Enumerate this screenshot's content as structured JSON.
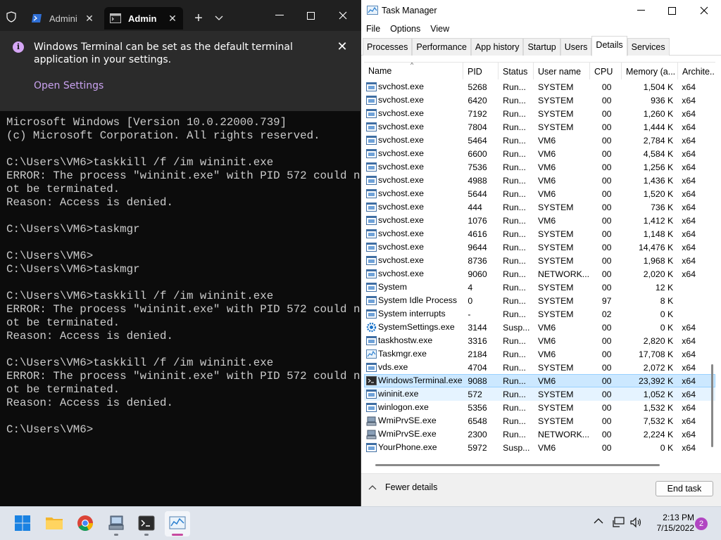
{
  "terminal": {
    "tabs": [
      {
        "label": "Admini",
        "icon": "powershell-icon"
      },
      {
        "label": "Admin",
        "icon": "cmd-icon",
        "active": true
      }
    ],
    "infobar": {
      "message": "Windows Terminal can be set as the default terminal application in your settings.",
      "link": "Open Settings"
    },
    "lines": [
      "Microsoft Windows [Version 10.0.22000.739]",
      "(c) Microsoft Corporation. All rights reserved.",
      "",
      "C:\\Users\\VM6>taskkill /f /im wininit.exe",
      "ERROR: The process \"wininit.exe\" with PID 572 could n",
      "ot be terminated.",
      "Reason: Access is denied.",
      "",
      "C:\\Users\\VM6>taskmgr",
      "",
      "C:\\Users\\VM6>",
      "C:\\Users\\VM6>taskmgr",
      "",
      "C:\\Users\\VM6>taskkill /f /im wininit.exe",
      "ERROR: The process \"wininit.exe\" with PID 572 could n",
      "ot be terminated.",
      "Reason: Access is denied.",
      "",
      "C:\\Users\\VM6>taskkill /f /im wininit.exe",
      "ERROR: The process \"wininit.exe\" with PID 572 could n",
      "ot be terminated.",
      "Reason: Access is denied.",
      "",
      "C:\\Users\\VM6>"
    ]
  },
  "taskmgr": {
    "title": "Task Manager",
    "menu": [
      "File",
      "Options",
      "View"
    ],
    "tabs": [
      "Processes",
      "Performance",
      "App history",
      "Startup",
      "Users",
      "Details",
      "Services"
    ],
    "active_tab": "Details",
    "columns": {
      "name": "Name",
      "pid": "PID",
      "status": "Status",
      "user": "User name",
      "cpu": "CPU",
      "mem": "Memory (a...",
      "arch": "Archite..."
    },
    "rows": [
      {
        "name": "svchost.exe",
        "pid": "5268",
        "status": "Run...",
        "user": "SYSTEM",
        "cpu": "00",
        "mem": "1,504 K",
        "arch": "x64",
        "icon": "service"
      },
      {
        "name": "svchost.exe",
        "pid": "6420",
        "status": "Run...",
        "user": "SYSTEM",
        "cpu": "00",
        "mem": "936 K",
        "arch": "x64",
        "icon": "service"
      },
      {
        "name": "svchost.exe",
        "pid": "7192",
        "status": "Run...",
        "user": "SYSTEM",
        "cpu": "00",
        "mem": "1,260 K",
        "arch": "x64",
        "icon": "service"
      },
      {
        "name": "svchost.exe",
        "pid": "7804",
        "status": "Run...",
        "user": "SYSTEM",
        "cpu": "00",
        "mem": "1,444 K",
        "arch": "x64",
        "icon": "service"
      },
      {
        "name": "svchost.exe",
        "pid": "5464",
        "status": "Run...",
        "user": "VM6",
        "cpu": "00",
        "mem": "2,784 K",
        "arch": "x64",
        "icon": "service"
      },
      {
        "name": "svchost.exe",
        "pid": "6600",
        "status": "Run...",
        "user": "VM6",
        "cpu": "00",
        "mem": "4,584 K",
        "arch": "x64",
        "icon": "service"
      },
      {
        "name": "svchost.exe",
        "pid": "7536",
        "status": "Run...",
        "user": "VM6",
        "cpu": "00",
        "mem": "1,256 K",
        "arch": "x64",
        "icon": "service"
      },
      {
        "name": "svchost.exe",
        "pid": "4988",
        "status": "Run...",
        "user": "VM6",
        "cpu": "00",
        "mem": "1,436 K",
        "arch": "x64",
        "icon": "service"
      },
      {
        "name": "svchost.exe",
        "pid": "5644",
        "status": "Run...",
        "user": "VM6",
        "cpu": "00",
        "mem": "1,520 K",
        "arch": "x64",
        "icon": "service"
      },
      {
        "name": "svchost.exe",
        "pid": "444",
        "status": "Run...",
        "user": "SYSTEM",
        "cpu": "00",
        "mem": "736 K",
        "arch": "x64",
        "icon": "service"
      },
      {
        "name": "svchost.exe",
        "pid": "1076",
        "status": "Run...",
        "user": "VM6",
        "cpu": "00",
        "mem": "1,412 K",
        "arch": "x64",
        "icon": "service"
      },
      {
        "name": "svchost.exe",
        "pid": "4616",
        "status": "Run...",
        "user": "SYSTEM",
        "cpu": "00",
        "mem": "1,148 K",
        "arch": "x64",
        "icon": "service"
      },
      {
        "name": "svchost.exe",
        "pid": "9644",
        "status": "Run...",
        "user": "SYSTEM",
        "cpu": "00",
        "mem": "14,476 K",
        "arch": "x64",
        "icon": "service"
      },
      {
        "name": "svchost.exe",
        "pid": "8736",
        "status": "Run...",
        "user": "SYSTEM",
        "cpu": "00",
        "mem": "1,968 K",
        "arch": "x64",
        "icon": "service"
      },
      {
        "name": "svchost.exe",
        "pid": "9060",
        "status": "Run...",
        "user": "NETWORK...",
        "cpu": "00",
        "mem": "2,020 K",
        "arch": "x64",
        "icon": "service"
      },
      {
        "name": "System",
        "pid": "4",
        "status": "Run...",
        "user": "SYSTEM",
        "cpu": "00",
        "mem": "12 K",
        "arch": "",
        "icon": "service"
      },
      {
        "name": "System Idle Process",
        "pid": "0",
        "status": "Run...",
        "user": "SYSTEM",
        "cpu": "97",
        "mem": "8 K",
        "arch": "",
        "icon": "service"
      },
      {
        "name": "System interrupts",
        "pid": "-",
        "status": "Run...",
        "user": "SYSTEM",
        "cpu": "02",
        "mem": "0 K",
        "arch": "",
        "icon": "service"
      },
      {
        "name": "SystemSettings.exe",
        "pid": "3144",
        "status": "Susp...",
        "user": "VM6",
        "cpu": "00",
        "mem": "0 K",
        "arch": "x64",
        "icon": "settings"
      },
      {
        "name": "taskhostw.exe",
        "pid": "3316",
        "status": "Run...",
        "user": "VM6",
        "cpu": "00",
        "mem": "2,820 K",
        "arch": "x64",
        "icon": "service"
      },
      {
        "name": "Taskmgr.exe",
        "pid": "2184",
        "status": "Run...",
        "user": "VM6",
        "cpu": "00",
        "mem": "17,708 K",
        "arch": "x64",
        "icon": "taskmgr"
      },
      {
        "name": "vds.exe",
        "pid": "4704",
        "status": "Run...",
        "user": "SYSTEM",
        "cpu": "00",
        "mem": "2,072 K",
        "arch": "x64",
        "icon": "service"
      },
      {
        "name": "WindowsTerminal.exe",
        "pid": "9088",
        "status": "Run...",
        "user": "VM6",
        "cpu": "00",
        "mem": "23,392 K",
        "arch": "x64",
        "icon": "terminal",
        "selected": true
      },
      {
        "name": "wininit.exe",
        "pid": "572",
        "status": "Run...",
        "user": "SYSTEM",
        "cpu": "00",
        "mem": "1,052 K",
        "arch": "x64",
        "icon": "service",
        "hover": true
      },
      {
        "name": "winlogon.exe",
        "pid": "5356",
        "status": "Run...",
        "user": "SYSTEM",
        "cpu": "00",
        "mem": "1,532 K",
        "arch": "x64",
        "icon": "service"
      },
      {
        "name": "WmiPrvSE.exe",
        "pid": "6548",
        "status": "Run...",
        "user": "SYSTEM",
        "cpu": "00",
        "mem": "7,532 K",
        "arch": "x64",
        "icon": "wmi"
      },
      {
        "name": "WmiPrvSE.exe",
        "pid": "2300",
        "status": "Run...",
        "user": "NETWORK...",
        "cpu": "00",
        "mem": "2,224 K",
        "arch": "x64",
        "icon": "wmi"
      },
      {
        "name": "YourPhone.exe",
        "pid": "5972",
        "status": "Susp...",
        "user": "VM6",
        "cpu": "00",
        "mem": "0 K",
        "arch": "x64",
        "icon": "service"
      }
    ],
    "footer": {
      "fewer_details": "Fewer details",
      "end_task": "End task"
    }
  },
  "taskbar": {
    "apps": [
      "start-icon",
      "file-explorer-icon",
      "chrome-icon",
      "computer-management-icon",
      "terminal-icon",
      "taskmgr-icon"
    ],
    "time": "2:13 PM",
    "date": "7/15/2022",
    "notification_count": "2"
  },
  "colors": {
    "selection": "#cce8ff",
    "accent_link": "#c9a2f0",
    "terminal_bg": "#0c0c0c",
    "badge": "#b146c2"
  }
}
